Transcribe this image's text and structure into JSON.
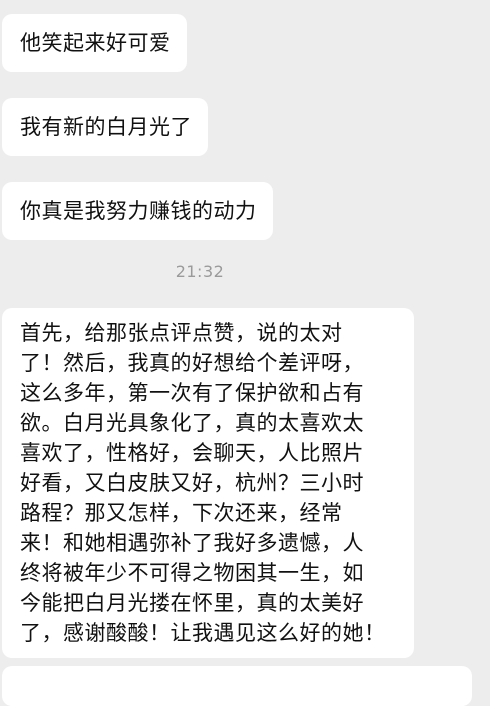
{
  "messages": [
    {
      "text": "他笑起来好可爱"
    },
    {
      "text": "我有新的白月光了"
    },
    {
      "text": "你真是我努力赚钱的动力"
    }
  ],
  "timestamp": "21:32",
  "long_message": {
    "lines": [
      "首先，给那张点评点赞，说的太对",
      "了！然后，我真的好想给个差评呀，",
      "这么多年，第一次有了保护欲和占有",
      "欲。白月光具象化了，真的太喜欢太",
      "喜欢了，性格好，会聊天，人比照片",
      "好看，又白皮肤又好，杭州？三小时",
      "路程？那又怎样，下次还来，经常",
      "来！和她相遇弥补了我好多遗憾，人",
      "终将被年少不可得之物困其一生，如",
      "今能把白月光搂在怀里，真的太美好",
      "了，感谢酸酸！让我遇见这么好的她！"
    ]
  },
  "colors": {
    "background": "#ededed",
    "bubble": "#ffffff",
    "text": "#111111",
    "timestamp": "#9a9a9a"
  }
}
